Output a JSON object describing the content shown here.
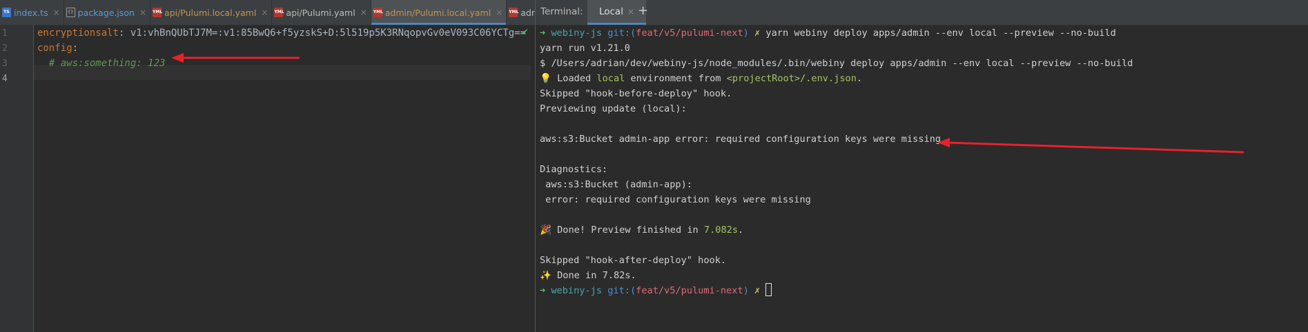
{
  "editor": {
    "tabs": [
      {
        "label": "index.ts",
        "file_type": "ts",
        "color": "#5a9bd5",
        "active": false
      },
      {
        "label": "package.json",
        "file_type": "json",
        "color": "#5a9bd5",
        "active": false
      },
      {
        "label": "api/Pulumi.local.yaml",
        "file_type": "yml",
        "color": "#c09553",
        "active": false
      },
      {
        "label": "api/Pulumi.yaml",
        "file_type": "yml",
        "color": "#bbbbbb",
        "active": false
      },
      {
        "label": "admin/Pulumi.local.yaml",
        "file_type": "yml",
        "color": "#c09553",
        "active": true
      },
      {
        "label": "admin/Pu",
        "file_type": "yml",
        "color": "#bbbbbb",
        "active": false
      }
    ],
    "line_numbers": [
      "1",
      "2",
      "3",
      "4"
    ],
    "code": {
      "line1_key": "encryptionsalt",
      "line1_sep": ": ",
      "line1_value": "v1:vhBnQUbTJ7M=:v1:85BwQ6+f5yzskS+D:5l519p5K3RNqopvGv0eV093C06YCTg==",
      "line2_key": "config",
      "line2_sep": ":",
      "line3_comment": "  # aws:something: 123"
    },
    "status_icon": "check-icon"
  },
  "terminal": {
    "title": "Terminal:",
    "tab_label": "Local",
    "tab_close": "×",
    "add_label": "+",
    "prompt_arrow": "➜",
    "prompt_dir": "webiny-js",
    "prompt_git": "git:(",
    "prompt_branch": "feat/v5/pulumi-next",
    "prompt_git_close": ")",
    "prompt_x": "✗",
    "command": "yarn webiny deploy apps/admin --env local --preview --no-build",
    "lines": {
      "yarn_run": "yarn run v1.21.0",
      "exec": "$ /Users/adrian/dev/webiny-js/node_modules/.bin/webiny deploy apps/admin --env local --preview --no-build",
      "loaded_icon": "💡",
      "loaded_pre": " Loaded ",
      "loaded_env": "local",
      "loaded_mid": " environment from ",
      "loaded_path": "<projectRoot>/.env.json",
      "loaded_end": ".",
      "skip_before": "Skipped \"hook-before-deploy\" hook.",
      "previewing": "Previewing update (local):",
      "error_main": "aws:s3:Bucket admin-app error: required configuration keys were missing",
      "diagnostics": "Diagnostics:",
      "diag_resource": " aws:s3:Bucket (admin-app):",
      "diag_error": " error: required configuration keys were missing",
      "done_icon": "🎉",
      "done_pre": " Done! Preview finished in ",
      "done_time": "7.082s",
      "done_end": ".",
      "skip_after": "Skipped \"hook-after-deploy\" hook.",
      "final_icon": "✨",
      "final_done": " Done in 7.82s."
    }
  },
  "colors": {
    "annotation_arrow": "#e8212b",
    "editor_bg": "#2b2b2b",
    "tab_accent": "#4a88c7"
  }
}
